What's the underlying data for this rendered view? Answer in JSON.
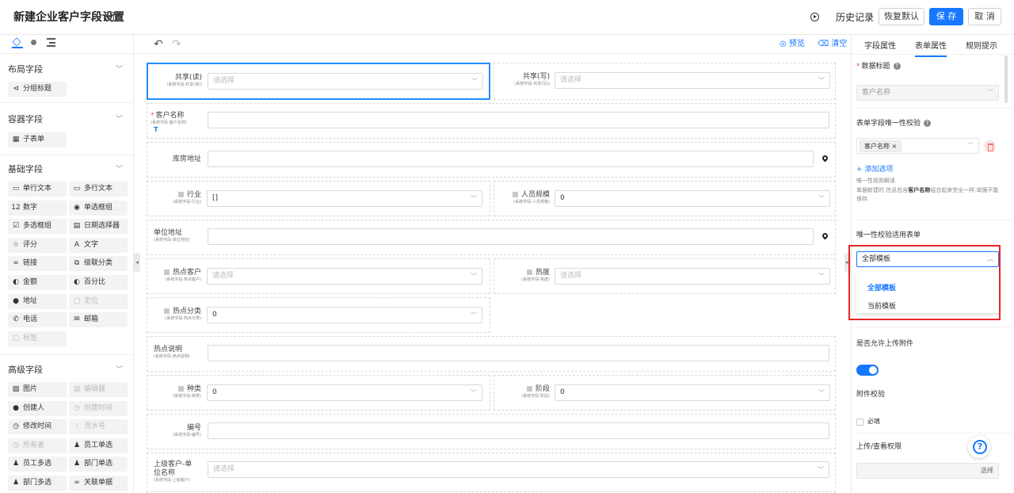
{
  "header": {
    "title": "新建企业客户字段设置",
    "history": "历史记录",
    "restore": "恢复默认",
    "save": "保 存",
    "cancel": "取 消"
  },
  "palette": {
    "sections": {
      "layout": "布局字段",
      "container": "容器字段",
      "basic": "基础字段",
      "advanced": "高级字段"
    },
    "layout_items": [
      {
        "icon": "⊲",
        "label": "分组标题"
      }
    ],
    "container_items": [
      {
        "icon": "▦",
        "label": "子表单"
      }
    ],
    "basic_items": [
      {
        "icon": "▭",
        "label": "单行文本",
        "disabled": false
      },
      {
        "icon": "▭",
        "label": "多行文本",
        "disabled": false
      },
      {
        "icon": "12",
        "label": "数字",
        "disabled": false
      },
      {
        "icon": "◉",
        "label": "单选框组",
        "disabled": false
      },
      {
        "icon": "☑",
        "label": "多选框组",
        "disabled": false
      },
      {
        "icon": "▤",
        "label": "日期选择器",
        "disabled": false
      },
      {
        "icon": "☆",
        "label": "评分",
        "disabled": false
      },
      {
        "icon": "A",
        "label": "文字",
        "disabled": false
      },
      {
        "icon": "∞",
        "label": "链接",
        "disabled": false
      },
      {
        "icon": "⧉",
        "label": "级联分类",
        "disabled": false
      },
      {
        "icon": "◐",
        "label": "金额",
        "disabled": false
      },
      {
        "icon": "◐",
        "label": "百分比",
        "disabled": false
      },
      {
        "icon": "●",
        "label": "地址",
        "disabled": false
      },
      {
        "icon": "▢",
        "label": "定位",
        "disabled": true
      },
      {
        "icon": "✆",
        "label": "电话",
        "disabled": false
      },
      {
        "icon": "✉",
        "label": "邮箱",
        "disabled": false
      },
      {
        "icon": "▢",
        "label": "标签",
        "disabled": true
      }
    ],
    "advanced_items": [
      {
        "icon": "▨",
        "label": "图片",
        "disabled": false
      },
      {
        "icon": "▤",
        "label": "编辑器",
        "disabled": true
      },
      {
        "icon": "●",
        "label": "创建人",
        "disabled": false
      },
      {
        "icon": "◷",
        "label": "创建时间",
        "disabled": true
      },
      {
        "icon": "◷",
        "label": "修改时间",
        "disabled": false
      },
      {
        "icon": "⁞",
        "label": "流水号",
        "disabled": true
      },
      {
        "icon": "◷",
        "label": "所有者",
        "disabled": true
      },
      {
        "icon": "♟",
        "label": "员工单选",
        "disabled": false
      },
      {
        "icon": "♟",
        "label": "员工多选",
        "disabled": false
      },
      {
        "icon": "♟",
        "label": "部门单选",
        "disabled": false
      },
      {
        "icon": "♟",
        "label": "部门多选",
        "disabled": false
      },
      {
        "icon": "∞",
        "label": "关联单据",
        "disabled": false
      }
    ]
  },
  "toolbar": {
    "undo": "↶",
    "redo": "↷",
    "preview": "◎ 预览",
    "clear": "⌫ 清空"
  },
  "form": {
    "share_read": {
      "label": "共享(读)",
      "sub": "(系统字段-共享(读))",
      "placeholder": "请选择"
    },
    "share_write": {
      "label": "共享(写)",
      "sub": "(系统字段-共享(写))",
      "placeholder": "请选择"
    },
    "customer_name": {
      "label": "客户名称",
      "sub": "(系统字段-客户名称)",
      "mark": "T"
    },
    "warehouse": {
      "label": "库房地址"
    },
    "industry": {
      "label": "行业",
      "sub": "(系统字段-行业)",
      "value": "[]"
    },
    "staff_size": {
      "label": "人员规模",
      "sub": "(系统字段-人员规模)",
      "value": "0"
    },
    "company_address": {
      "label": "单位地址",
      "sub": "(系统字段-单位地址)"
    },
    "hot_customer": {
      "label": "热点客户",
      "sub": "(系统字段-热点客户)",
      "placeholder": "请选择"
    },
    "heat": {
      "label": "热度",
      "sub": "(系统字段-热度)",
      "placeholder": "请选择"
    },
    "hot_category": {
      "label": "热点分类",
      "sub": "(系统字段-热点分类)",
      "value": "0"
    },
    "hot_desc": {
      "label": "热点说明",
      "sub": "(系统字段-热点说明)"
    },
    "species": {
      "label": "种类",
      "sub": "(系统字段-种类)",
      "value": "0"
    },
    "stage": {
      "label": "阶段",
      "sub": "(系统字段-阶段)",
      "value": "0"
    },
    "number": {
      "label": "编号",
      "sub": "(系统字段-编号)"
    },
    "parent": {
      "label1": "上级客户-单",
      "label2": "位名称",
      "sub": "(系统字段-上级客户)",
      "placeholder": "请选择"
    }
  },
  "props": {
    "tabs": [
      "字段属性",
      "表单属性",
      "规则提示"
    ],
    "data_title": "数据标题",
    "data_title_value": "客户名称",
    "unique_check": "表单字段唯一性校验",
    "unique_tag": "客户名称 ×",
    "add_option": "+ 添加选项",
    "rule_title": "唯一性规则解读",
    "rule_text1": "单据新建时,信息包含",
    "rule_bold": "客户名称",
    "rule_text2": "组合起来完全一样,单据不能保存.",
    "applies_label": "唯一性校验适用表单",
    "applies_value": "全部模板",
    "options": [
      "全部模板",
      "当前模板"
    ],
    "allow_upload": "是否允许上传附件",
    "attach_check": "附件校验",
    "required": "必填",
    "perm": "上传/查看权限",
    "choose": "选择"
  }
}
